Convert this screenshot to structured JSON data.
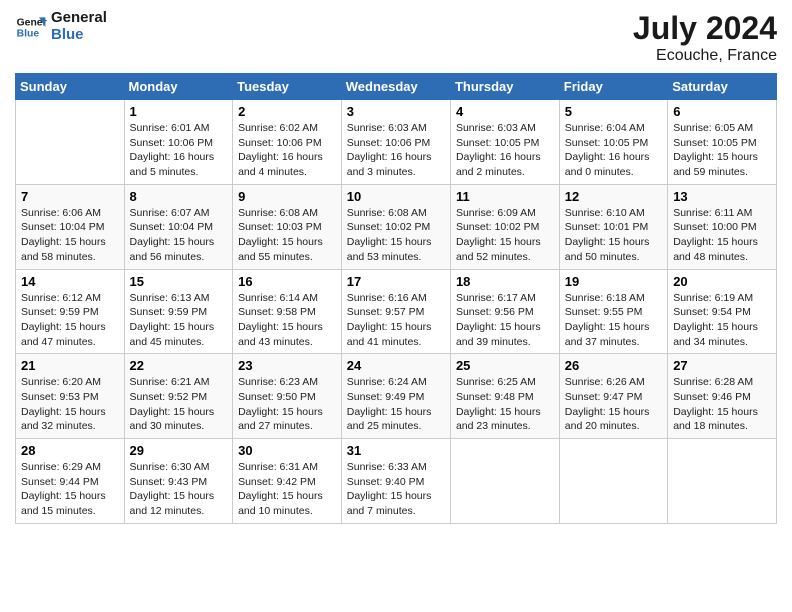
{
  "header": {
    "logo_general": "General",
    "logo_blue": "Blue",
    "month_title": "July 2024",
    "location": "Ecouche, France"
  },
  "columns": [
    "Sunday",
    "Monday",
    "Tuesday",
    "Wednesday",
    "Thursday",
    "Friday",
    "Saturday"
  ],
  "weeks": [
    [
      {
        "day": "",
        "info": ""
      },
      {
        "day": "1",
        "info": "Sunrise: 6:01 AM\nSunset: 10:06 PM\nDaylight: 16 hours\nand 5 minutes."
      },
      {
        "day": "2",
        "info": "Sunrise: 6:02 AM\nSunset: 10:06 PM\nDaylight: 16 hours\nand 4 minutes."
      },
      {
        "day": "3",
        "info": "Sunrise: 6:03 AM\nSunset: 10:06 PM\nDaylight: 16 hours\nand 3 minutes."
      },
      {
        "day": "4",
        "info": "Sunrise: 6:03 AM\nSunset: 10:05 PM\nDaylight: 16 hours\nand 2 minutes."
      },
      {
        "day": "5",
        "info": "Sunrise: 6:04 AM\nSunset: 10:05 PM\nDaylight: 16 hours\nand 0 minutes."
      },
      {
        "day": "6",
        "info": "Sunrise: 6:05 AM\nSunset: 10:05 PM\nDaylight: 15 hours\nand 59 minutes."
      }
    ],
    [
      {
        "day": "7",
        "info": "Sunrise: 6:06 AM\nSunset: 10:04 PM\nDaylight: 15 hours\nand 58 minutes."
      },
      {
        "day": "8",
        "info": "Sunrise: 6:07 AM\nSunset: 10:04 PM\nDaylight: 15 hours\nand 56 minutes."
      },
      {
        "day": "9",
        "info": "Sunrise: 6:08 AM\nSunset: 10:03 PM\nDaylight: 15 hours\nand 55 minutes."
      },
      {
        "day": "10",
        "info": "Sunrise: 6:08 AM\nSunset: 10:02 PM\nDaylight: 15 hours\nand 53 minutes."
      },
      {
        "day": "11",
        "info": "Sunrise: 6:09 AM\nSunset: 10:02 PM\nDaylight: 15 hours\nand 52 minutes."
      },
      {
        "day": "12",
        "info": "Sunrise: 6:10 AM\nSunset: 10:01 PM\nDaylight: 15 hours\nand 50 minutes."
      },
      {
        "day": "13",
        "info": "Sunrise: 6:11 AM\nSunset: 10:00 PM\nDaylight: 15 hours\nand 48 minutes."
      }
    ],
    [
      {
        "day": "14",
        "info": "Sunrise: 6:12 AM\nSunset: 9:59 PM\nDaylight: 15 hours\nand 47 minutes."
      },
      {
        "day": "15",
        "info": "Sunrise: 6:13 AM\nSunset: 9:59 PM\nDaylight: 15 hours\nand 45 minutes."
      },
      {
        "day": "16",
        "info": "Sunrise: 6:14 AM\nSunset: 9:58 PM\nDaylight: 15 hours\nand 43 minutes."
      },
      {
        "day": "17",
        "info": "Sunrise: 6:16 AM\nSunset: 9:57 PM\nDaylight: 15 hours\nand 41 minutes."
      },
      {
        "day": "18",
        "info": "Sunrise: 6:17 AM\nSunset: 9:56 PM\nDaylight: 15 hours\nand 39 minutes."
      },
      {
        "day": "19",
        "info": "Sunrise: 6:18 AM\nSunset: 9:55 PM\nDaylight: 15 hours\nand 37 minutes."
      },
      {
        "day": "20",
        "info": "Sunrise: 6:19 AM\nSunset: 9:54 PM\nDaylight: 15 hours\nand 34 minutes."
      }
    ],
    [
      {
        "day": "21",
        "info": "Sunrise: 6:20 AM\nSunset: 9:53 PM\nDaylight: 15 hours\nand 32 minutes."
      },
      {
        "day": "22",
        "info": "Sunrise: 6:21 AM\nSunset: 9:52 PM\nDaylight: 15 hours\nand 30 minutes."
      },
      {
        "day": "23",
        "info": "Sunrise: 6:23 AM\nSunset: 9:50 PM\nDaylight: 15 hours\nand 27 minutes."
      },
      {
        "day": "24",
        "info": "Sunrise: 6:24 AM\nSunset: 9:49 PM\nDaylight: 15 hours\nand 25 minutes."
      },
      {
        "day": "25",
        "info": "Sunrise: 6:25 AM\nSunset: 9:48 PM\nDaylight: 15 hours\nand 23 minutes."
      },
      {
        "day": "26",
        "info": "Sunrise: 6:26 AM\nSunset: 9:47 PM\nDaylight: 15 hours\nand 20 minutes."
      },
      {
        "day": "27",
        "info": "Sunrise: 6:28 AM\nSunset: 9:46 PM\nDaylight: 15 hours\nand 18 minutes."
      }
    ],
    [
      {
        "day": "28",
        "info": "Sunrise: 6:29 AM\nSunset: 9:44 PM\nDaylight: 15 hours\nand 15 minutes."
      },
      {
        "day": "29",
        "info": "Sunrise: 6:30 AM\nSunset: 9:43 PM\nDaylight: 15 hours\nand 12 minutes."
      },
      {
        "day": "30",
        "info": "Sunrise: 6:31 AM\nSunset: 9:42 PM\nDaylight: 15 hours\nand 10 minutes."
      },
      {
        "day": "31",
        "info": "Sunrise: 6:33 AM\nSunset: 9:40 PM\nDaylight: 15 hours\nand 7 minutes."
      },
      {
        "day": "",
        "info": ""
      },
      {
        "day": "",
        "info": ""
      },
      {
        "day": "",
        "info": ""
      }
    ]
  ]
}
